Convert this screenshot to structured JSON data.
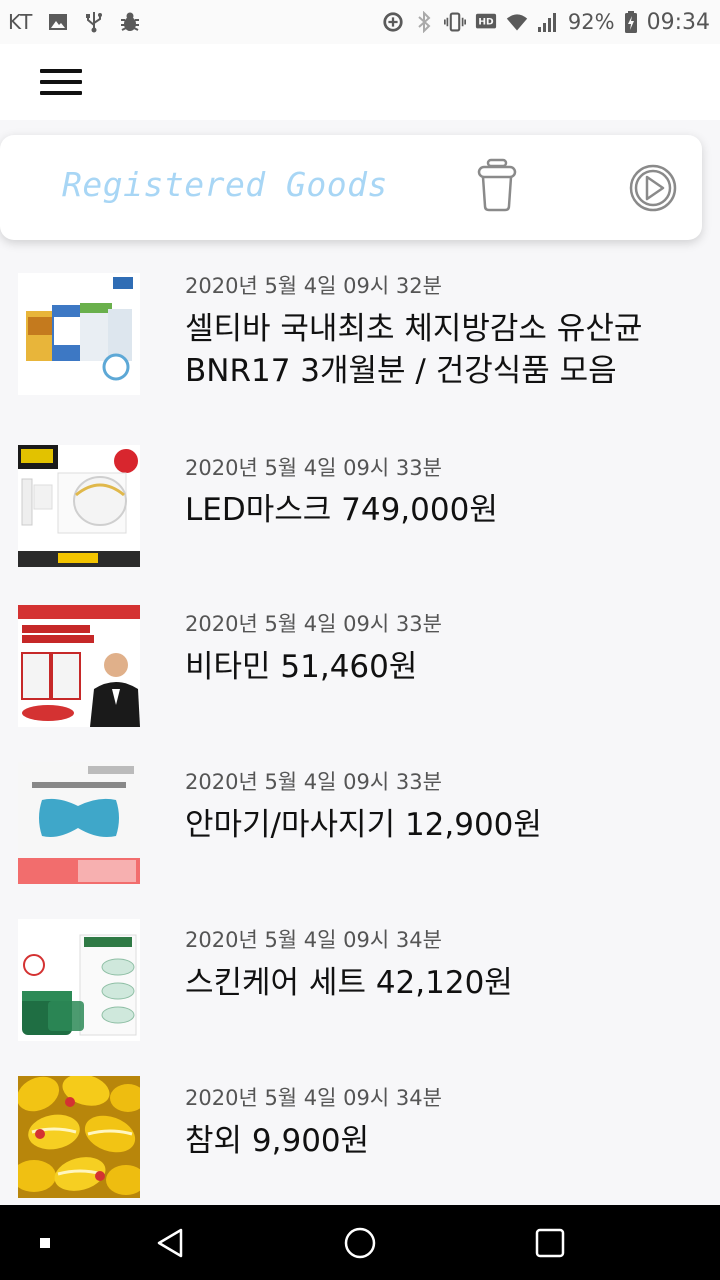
{
  "status_bar": {
    "carrier": "KT",
    "battery": "92%",
    "time": "09:34",
    "icons": [
      "image-icon",
      "usb-icon",
      "bug-icon",
      "data-saver-icon",
      "bluetooth-icon",
      "vibrate-icon",
      "hd-icon",
      "wifi-icon",
      "signal-icon",
      "battery-icon"
    ]
  },
  "app_bar": {
    "menu_icon": "hamburger-menu-icon"
  },
  "card": {
    "title": "Registered Goods",
    "title_color": "#a8d6f5",
    "delete_icon": "trash-icon",
    "play_icon": "play-circle-icon"
  },
  "items": [
    {
      "date": "2020년 5월 4일 09시 32분",
      "title": " 셀티바 국내최초 체지방감소 유산균 BNR17 3개월분 / 건강식품 모음"
    },
    {
      "date": "2020년 5월 4일 09시 33분",
      "title": "LED마스크 749,000원"
    },
    {
      "date": "2020년 5월 4일 09시 33분",
      "title": "비타민 51,460원"
    },
    {
      "date": "2020년 5월 4일 09시 33분",
      "title": "안마기/마사지기 12,900원"
    },
    {
      "date": "2020년 5월 4일 09시 34분",
      "title": "스킨케어 세트 42,120원"
    },
    {
      "date": "2020년 5월 4일 09시 34분",
      "title": "참외 9,900원"
    }
  ],
  "nav_bar": {
    "icons": [
      "recents-dot-icon",
      "back-icon",
      "home-icon",
      "overview-icon"
    ]
  }
}
